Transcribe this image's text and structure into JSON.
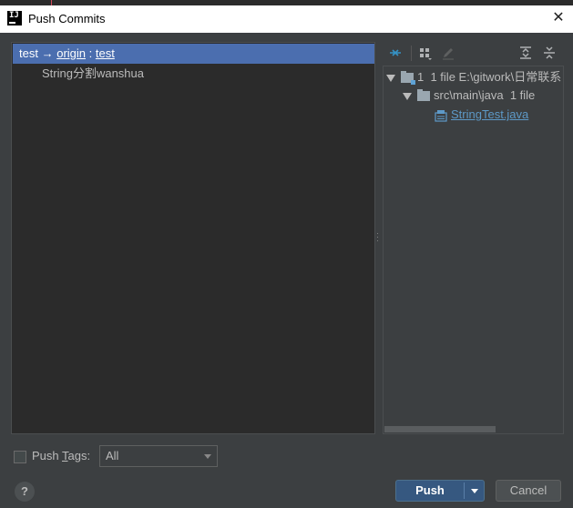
{
  "window": {
    "title": "Push Commits"
  },
  "branch": {
    "local": "test",
    "arrow": "→",
    "remote": "origin",
    "sep": " : ",
    "target": "test"
  },
  "commits": [
    {
      "message": "String分割wanshua"
    }
  ],
  "changes": {
    "root": {
      "count_text": "1",
      "summary": "1 file  E:\\gitwork\\日常联系"
    },
    "dir": {
      "path": "src\\main\\java",
      "summary": "1 file"
    },
    "file": {
      "name": "StringTest.java"
    }
  },
  "toolbar_icons": [
    "expand-arrows-icon",
    "group-by-icon",
    "edit-icon",
    "expand-all-icon",
    "collapse-all-icon"
  ],
  "footer": {
    "push_tags_label_pre": "Push ",
    "push_tags_label_mnemonic": "T",
    "push_tags_label_post": "ags:",
    "tags_select_value": "All",
    "help_label": "?",
    "push_label": "Push",
    "cancel_label": "Cancel"
  },
  "colors": {
    "selection": "#4b6eaf",
    "file_link": "#5d99c7",
    "primary_button": "#365880"
  }
}
